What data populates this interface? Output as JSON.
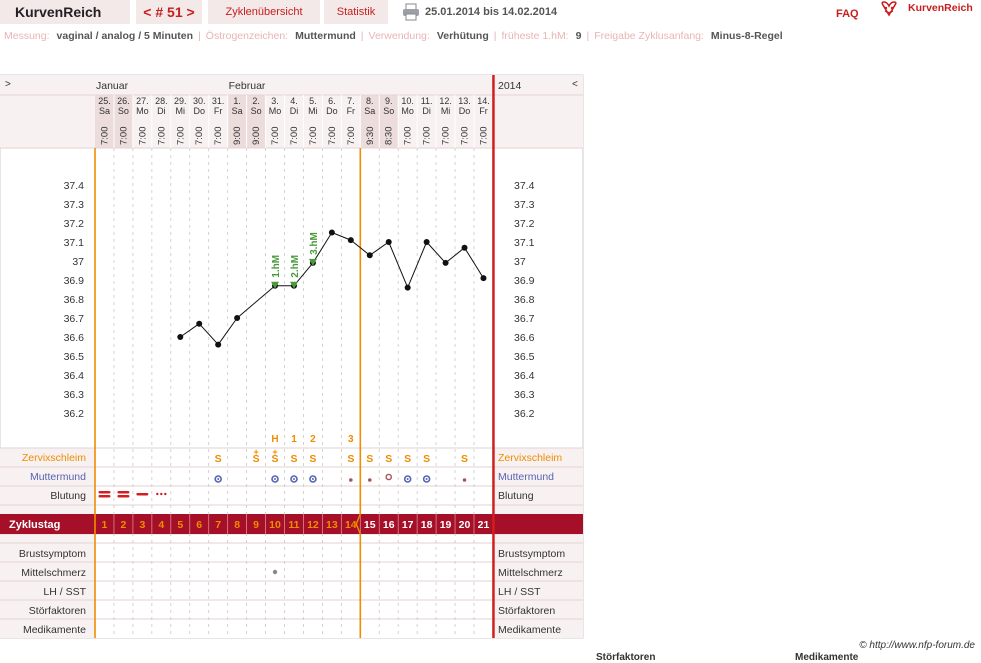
{
  "header": {
    "app_name": "KurvenReich",
    "cycle_nav": "< # 51 >",
    "tab_overview": "Zyklenübersicht",
    "tab_stats": "Statistik",
    "date_range": "25.01.2014 bis 14.02.2014",
    "faq": "FAQ",
    "logo_text": "KurvenReich"
  },
  "meta": {
    "messung_label": "Messung:",
    "messung_value": "vaginal / analog / 5 Minuten",
    "oestrogen_label": "Östrogenzeichen:",
    "oestrogen_value": "Muttermund",
    "verwendung_label": "Verwendung:",
    "verwendung_value": "Verhütung",
    "hm_label": "früheste 1.hM:",
    "hm_value": "9",
    "freigabe_label": "Freigabe Zyklusanfang:",
    "freigabe_value": "Minus-8-Regel"
  },
  "chart_data": {
    "type": "line",
    "left_nav": ">",
    "right_nav": "<",
    "year": "2014",
    "months": [
      {
        "label": "Januar",
        "day_index": 0
      },
      {
        "label": "Februar",
        "day_index": 7
      }
    ],
    "days": [
      {
        "date": "25.",
        "wd": "Sa",
        "time": "7:00",
        "temp": null
      },
      {
        "date": "26.",
        "wd": "So",
        "time": "7:00",
        "temp": null
      },
      {
        "date": "27.",
        "wd": "Mo",
        "time": "7:00",
        "temp": null
      },
      {
        "date": "28.",
        "wd": "Di",
        "time": "7:00",
        "temp": null
      },
      {
        "date": "29.",
        "wd": "Mi",
        "time": "7:00",
        "temp": 36.6
      },
      {
        "date": "30.",
        "wd": "Do",
        "time": "7:00",
        "temp": 36.67
      },
      {
        "date": "31.",
        "wd": "Fr",
        "time": "7:00",
        "temp": 36.56
      },
      {
        "date": "1.",
        "wd": "Sa",
        "time": "9:00",
        "temp": 36.7
      },
      {
        "date": "2.",
        "wd": "So",
        "time": "9:00",
        "temp": null
      },
      {
        "date": "3.",
        "wd": "Mo",
        "time": "7:00",
        "temp": 36.87
      },
      {
        "date": "4.",
        "wd": "Di",
        "time": "7:00",
        "temp": 36.87
      },
      {
        "date": "5.",
        "wd": "Mi",
        "time": "7:00",
        "temp": 36.99
      },
      {
        "date": "6.",
        "wd": "Do",
        "time": "7:00",
        "temp": 37.15
      },
      {
        "date": "7.",
        "wd": "Fr",
        "time": "7:00",
        "temp": 37.11
      },
      {
        "date": "8.",
        "wd": "Sa",
        "time": "9:30",
        "temp": 37.03
      },
      {
        "date": "9.",
        "wd": "So",
        "time": "8:30",
        "temp": 37.1
      },
      {
        "date": "10.",
        "wd": "Mo",
        "time": "7:00",
        "temp": 36.86
      },
      {
        "date": "11.",
        "wd": "Di",
        "time": "7:00",
        "temp": 37.1
      },
      {
        "date": "12.",
        "wd": "Mi",
        "time": "7:00",
        "temp": 36.99
      },
      {
        "date": "13.",
        "wd": "Do",
        "time": "7:00",
        "temp": 37.07
      },
      {
        "date": "14.",
        "wd": "Fr",
        "time": "7:00",
        "temp": 36.91
      }
    ],
    "y_ticks": [
      "37.4",
      "37.3",
      "37.2",
      "37.1",
      "37",
      "36.9",
      "36.8",
      "36.7",
      "36.6",
      "36.5",
      "36.4",
      "36.3",
      "36.2"
    ],
    "ylim": [
      36.2,
      37.4
    ],
    "hm_markers": [
      {
        "day_index": 9,
        "label": "1.hM"
      },
      {
        "day_index": 10,
        "label": "2.hM"
      },
      {
        "day_index": 11,
        "label": "3.hM"
      }
    ],
    "evaluation_day_index": 13,
    "top_marks": [
      {
        "day_index": 9,
        "label": "H"
      },
      {
        "day_index": 10,
        "label": "1"
      },
      {
        "day_index": 11,
        "label": "2"
      },
      {
        "day_index": 13,
        "label": "3"
      }
    ],
    "zervix": [
      null,
      null,
      null,
      null,
      null,
      null,
      "S",
      null,
      "S+",
      "S+",
      "S",
      "S",
      null,
      "S",
      "S",
      "S",
      "S",
      "S",
      null,
      "S",
      null
    ],
    "muttermund": [
      null,
      null,
      null,
      null,
      null,
      null,
      "open",
      null,
      null,
      "open",
      "open",
      "open",
      null,
      "dot",
      "dot",
      "circle",
      "open",
      "open",
      null,
      "dot",
      null
    ],
    "blutung": [
      "heavy",
      "heavy",
      "medium",
      "light",
      null,
      null,
      null,
      null,
      null,
      null,
      null,
      null,
      null,
      null,
      null,
      null,
      null,
      null,
      null,
      null,
      null
    ],
    "zyklustag_label": "Zyklustag",
    "zyklustag": [
      "1",
      "2",
      "3",
      "4",
      "5",
      "6",
      "7",
      "8",
      "9",
      "10",
      "11",
      "12",
      "13",
      "14",
      "15",
      "16",
      "17",
      "18",
      "19",
      "20",
      "21"
    ],
    "mittelschmerz_day_index": 9,
    "row_labels": {
      "zervix": "Zervixschleim",
      "muttermund": "Muttermund",
      "blutung": "Blutung",
      "brust": "Brustsymptom",
      "mittelschmerz": "Mittelschmerz",
      "lh": "LH / SST",
      "stoer": "Störfaktoren",
      "medi": "Medikamente"
    },
    "colors": {
      "accent": "#a50f28",
      "orange": "#f08c00",
      "mm_blue": "#5564b4",
      "grid": "#c8c8c8",
      "zervix_text": "#f08c00"
    }
  },
  "footer": {
    "copyright": "© http://www.nfp-forum.de",
    "cut_left": "Störfaktoren",
    "cut_right": "Medikamente"
  }
}
